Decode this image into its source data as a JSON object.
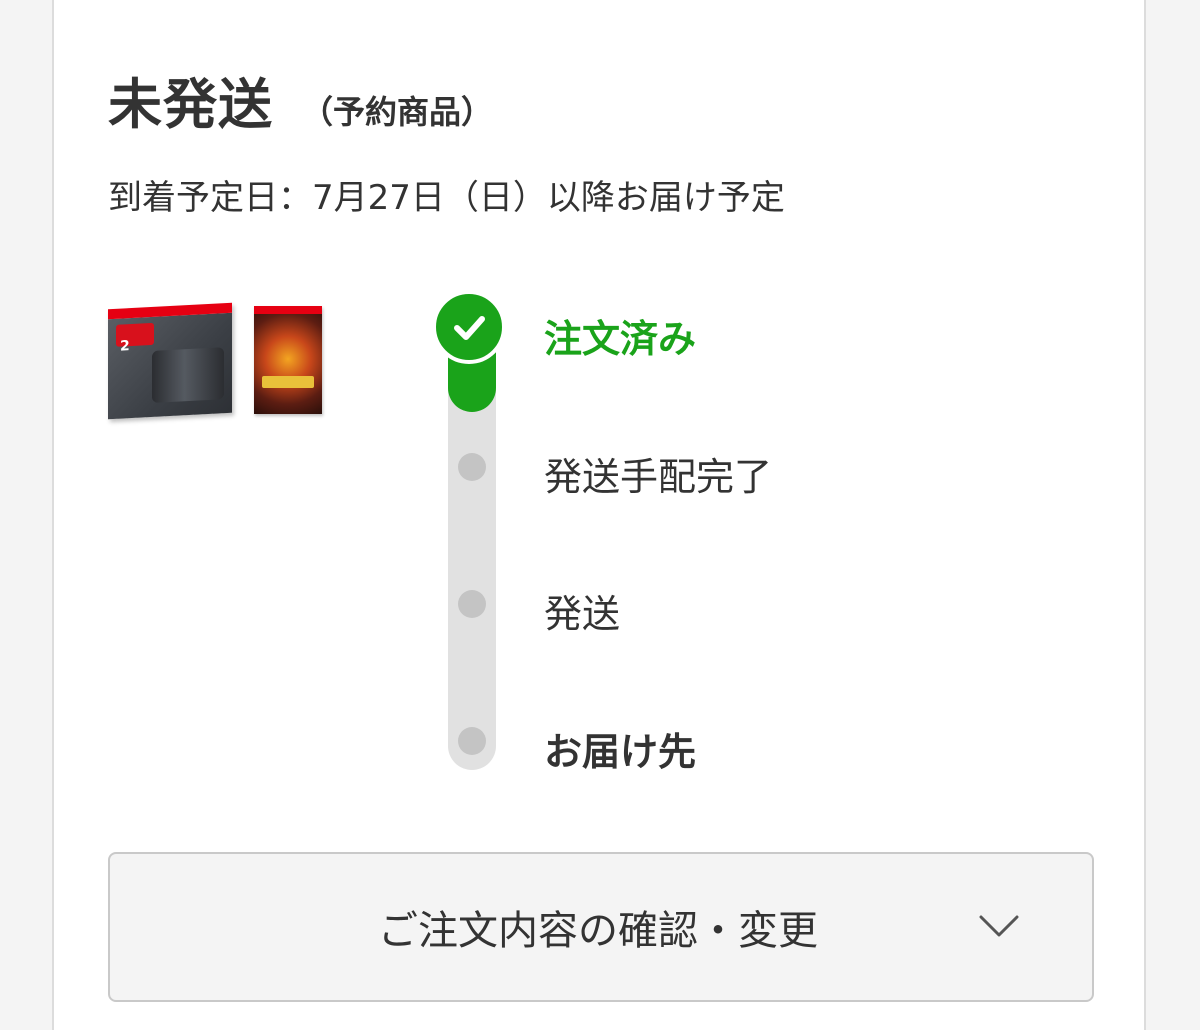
{
  "shipment": {
    "title": "未発送",
    "subtitle": "（予約商品）",
    "arrival_text": "到着予定日：7月27日（日）以降お届け予定"
  },
  "products": [
    {
      "icon": "console-box-image",
      "box_text": "2"
    },
    {
      "icon": "game-box-image"
    }
  ],
  "progress": {
    "current_step_index": 0,
    "steps": [
      {
        "label": "注文済み",
        "state": "done"
      },
      {
        "label": "発送手配完了",
        "state": "pending"
      },
      {
        "label": "発送",
        "state": "pending"
      },
      {
        "label": "お届け先",
        "state": "pending"
      }
    ]
  },
  "order_details_button": {
    "label": "ご注文内容の確認・変更",
    "icon": "chevron-down-icon"
  },
  "colors": {
    "accent_green": "#1aa31a",
    "track_gray": "#e1e1e1",
    "dot_gray": "#c4c4c4",
    "text": "#333333"
  }
}
